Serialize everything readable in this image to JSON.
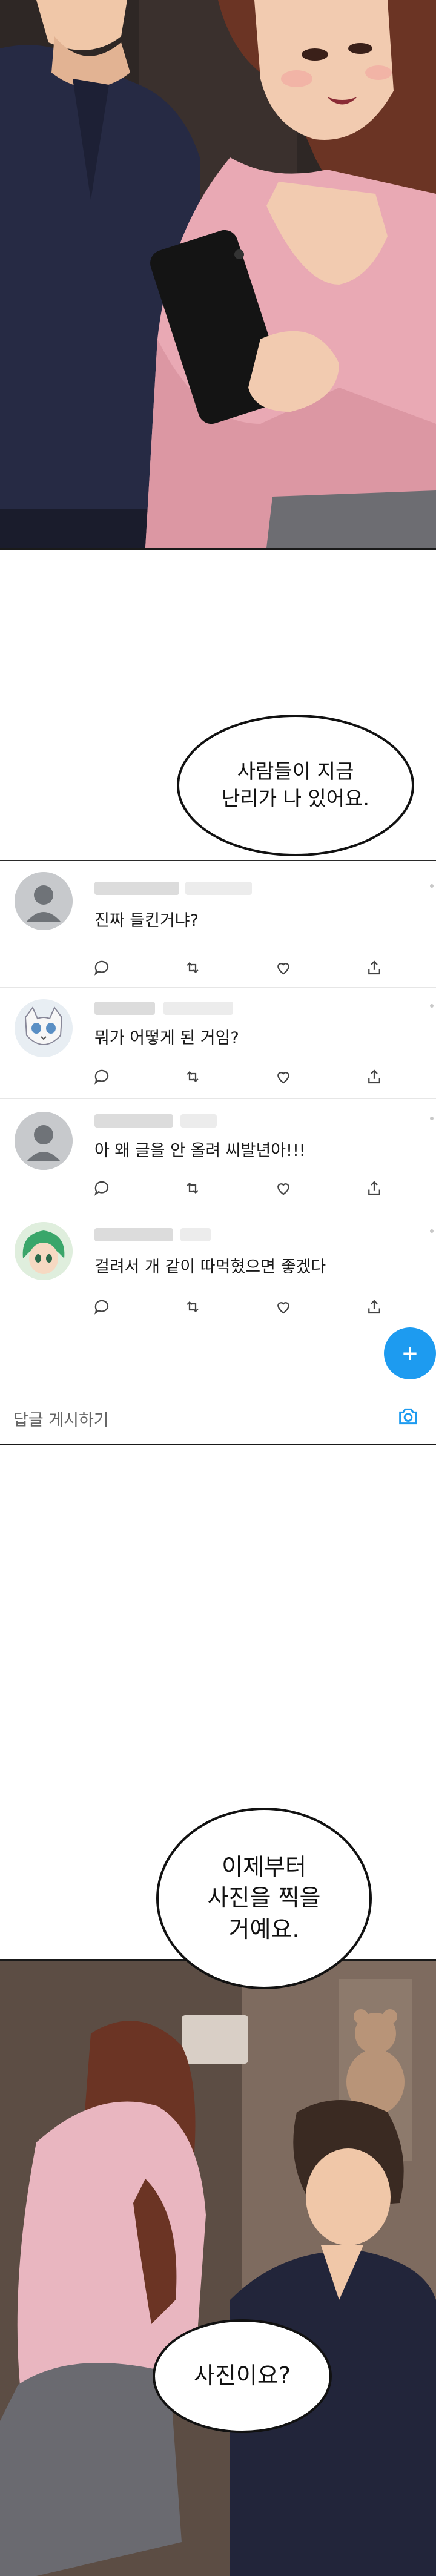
{
  "panel_top": {
    "description_icons": [
      "man-figure",
      "woman-figure",
      "smartphone"
    ]
  },
  "bubble1": {
    "line1": "사람들이 지금",
    "line2": "난리가 나 있어요."
  },
  "feed": {
    "posts": [
      {
        "text": "진짜 들킨거냐?"
      },
      {
        "text": "뭐가 어떻게 된 거임?"
      },
      {
        "text": "아 왜 글을 안 올려 씨발년아!!!"
      },
      {
        "text": "걸려서 개 같이 따먹혔으면 좋겠다"
      }
    ],
    "fab_label": "+",
    "reply_placeholder": "답글 게시하기"
  },
  "bubble2": {
    "line1": "이제부터",
    "line2": "사진을 찍을",
    "line3": "거예요."
  },
  "bubble3": {
    "line1": "사진이요?"
  },
  "colors": {
    "accent": "#1d9bf0",
    "skin": "#f0c7a8",
    "pink_top": "#e9a9b4",
    "navy_shirt": "#262a44",
    "hair_brown": "#6b3424"
  }
}
